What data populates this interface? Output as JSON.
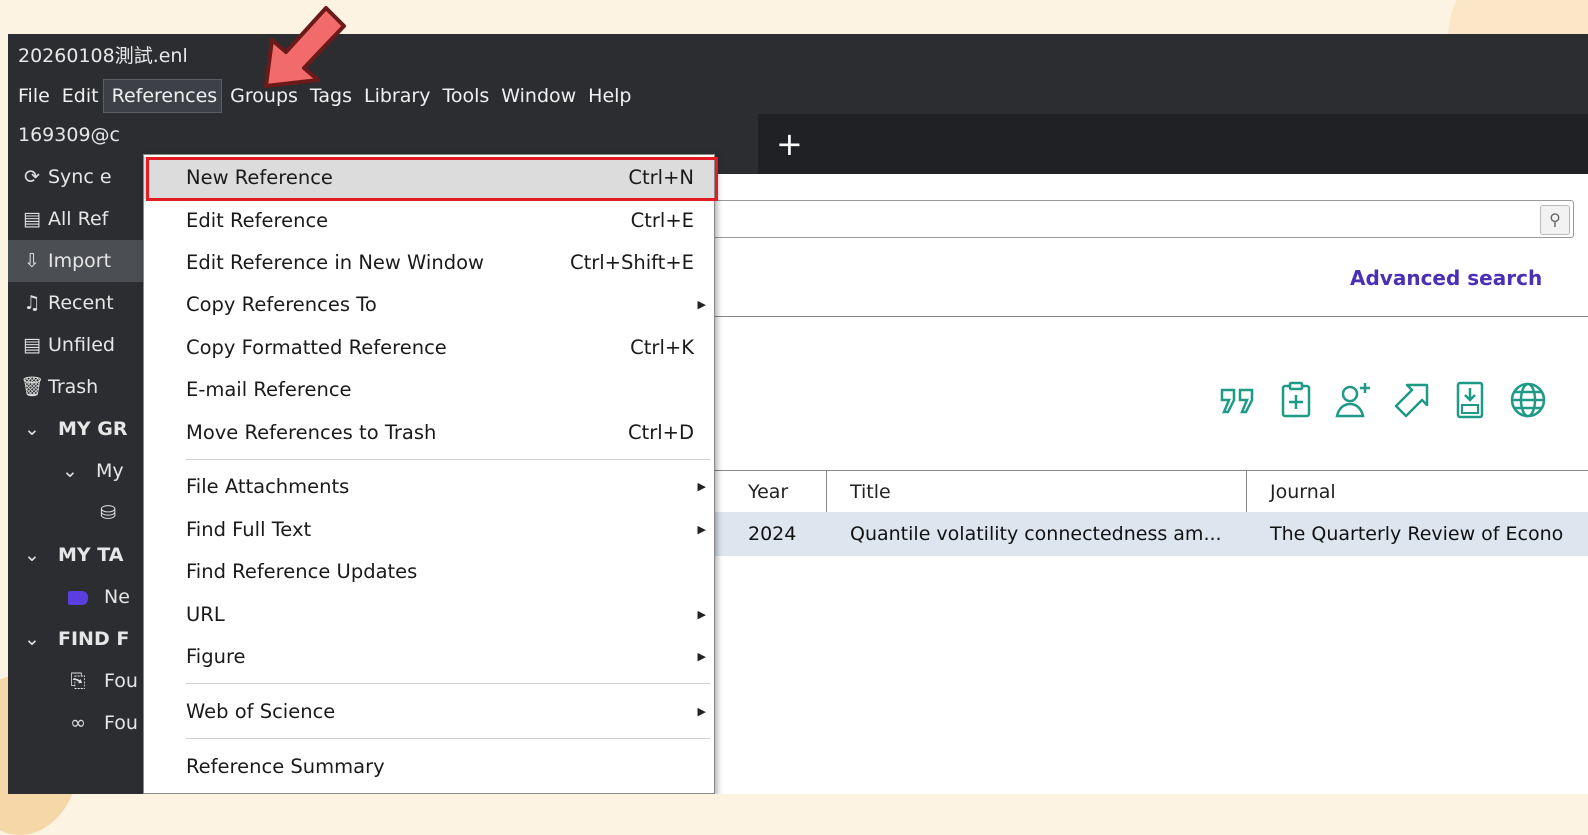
{
  "window": {
    "title": "20260108測試.enl"
  },
  "menubar": [
    "File",
    "Edit",
    "References",
    "Groups",
    "Tags",
    "Library",
    "Tools",
    "Window",
    "Help"
  ],
  "sidebar": {
    "account": "169309@c",
    "sync": "Sync e",
    "all_refs": "All Ref",
    "imported": "Import",
    "recent": "Recent",
    "unfiled": "Unfiled",
    "trash": "Trash",
    "my_groups": "MY GR",
    "my_group_item": "My",
    "my_tags": "MY TA",
    "tag_item": "Ne",
    "find_full_text": "FIND F",
    "found_pdf": "Fou",
    "found_url": "Fou"
  },
  "tabs": {
    "add_label": "+"
  },
  "search": {
    "advanced_label": "Advanced search"
  },
  "table": {
    "headers": {
      "year": "Year",
      "title": "Title",
      "journal": "Journal"
    },
    "rows": [
      {
        "year": "2024",
        "title": "Quantile volatility connectedness am...",
        "journal": "The Quarterly Review of Econo"
      }
    ]
  },
  "references_menu": {
    "items": [
      {
        "label": "New Reference",
        "shortcut": "Ctrl+N"
      },
      {
        "label": "Edit Reference",
        "shortcut": "Ctrl+E"
      },
      {
        "label": "Edit Reference in New Window",
        "shortcut": "Ctrl+Shift+E"
      },
      {
        "label": "Copy References To",
        "shortcut": ""
      },
      {
        "label": "Copy Formatted Reference",
        "shortcut": "Ctrl+K"
      },
      {
        "label": "E-mail Reference",
        "shortcut": ""
      },
      {
        "label": "Move References to Trash",
        "shortcut": "Ctrl+D"
      },
      {
        "label": "File Attachments",
        "shortcut": ""
      },
      {
        "label": "Find Full Text",
        "shortcut": ""
      },
      {
        "label": "Find Reference Updates",
        "shortcut": ""
      },
      {
        "label": "URL",
        "shortcut": ""
      },
      {
        "label": "Figure",
        "shortcut": ""
      },
      {
        "label": "Web of Science",
        "shortcut": ""
      },
      {
        "label": "Reference Summary",
        "shortcut": ""
      }
    ]
  },
  "colors": {
    "highlight_box": "#e31b23",
    "callout_arrow": "#f26b6b",
    "toolbar_icon": "#1e9a86",
    "advanced_search_link": "#4b2fb5",
    "tag_color": "#5b3ee0"
  }
}
